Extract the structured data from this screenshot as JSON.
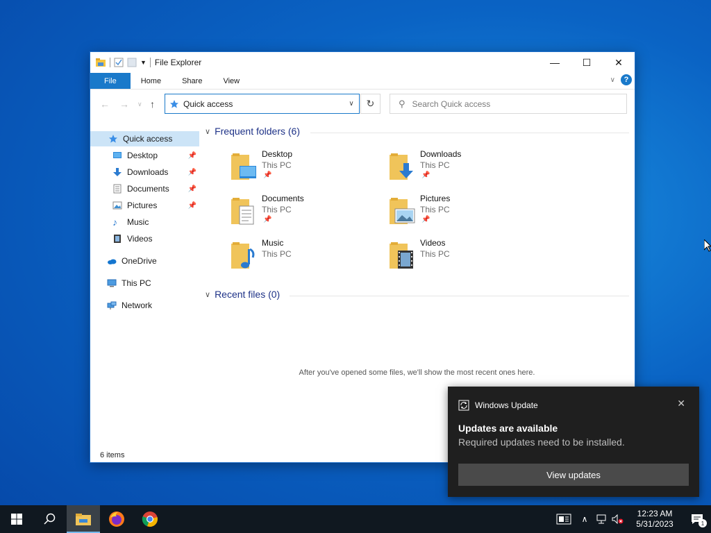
{
  "window": {
    "title": "File Explorer",
    "controls": {
      "minimize": "—",
      "maximize": "☐",
      "close": "✕"
    }
  },
  "ribbon": {
    "tabs": [
      "File",
      "Home",
      "Share",
      "View"
    ]
  },
  "address": {
    "value": "Quick access",
    "search_placeholder": "Search Quick access"
  },
  "navpane": {
    "items": [
      {
        "label": "Quick access",
        "icon": "star-icon",
        "active": true,
        "pinned": false
      },
      {
        "label": "Desktop",
        "icon": "desktop-icon",
        "pinned": true
      },
      {
        "label": "Downloads",
        "icon": "download-icon",
        "pinned": true
      },
      {
        "label": "Documents",
        "icon": "document-icon",
        "pinned": true
      },
      {
        "label": "Pictures",
        "icon": "pictures-icon",
        "pinned": true
      },
      {
        "label": "Music",
        "icon": "music-icon",
        "pinned": false
      },
      {
        "label": "Videos",
        "icon": "video-icon",
        "pinned": false
      },
      {
        "label": "OneDrive",
        "icon": "cloud-icon",
        "pinned": false
      },
      {
        "label": "This PC",
        "icon": "computer-icon",
        "pinned": false
      },
      {
        "label": "Network",
        "icon": "network-icon",
        "pinned": false
      }
    ]
  },
  "content": {
    "frequent_header": "Frequent folders (6)",
    "recent_header": "Recent files (0)",
    "empty_message": "After you've opened some files, we'll show the most recent ones here.",
    "folders": [
      {
        "name": "Desktop",
        "location": "This PC",
        "pinned": true
      },
      {
        "name": "Downloads",
        "location": "This PC",
        "pinned": true
      },
      {
        "name": "Documents",
        "location": "This PC",
        "pinned": true
      },
      {
        "name": "Pictures",
        "location": "This PC",
        "pinned": true
      },
      {
        "name": "Music",
        "location": "This PC",
        "pinned": false
      },
      {
        "name": "Videos",
        "location": "This PC",
        "pinned": false
      }
    ]
  },
  "status": {
    "items": "6 items"
  },
  "toast": {
    "app": "Windows Update",
    "heading": "Updates are available",
    "body": "Required updates need to be installed.",
    "action": "View updates"
  },
  "taskbar": {
    "time": "12:23 AM",
    "date": "5/31/2023",
    "notification_count": "1"
  }
}
